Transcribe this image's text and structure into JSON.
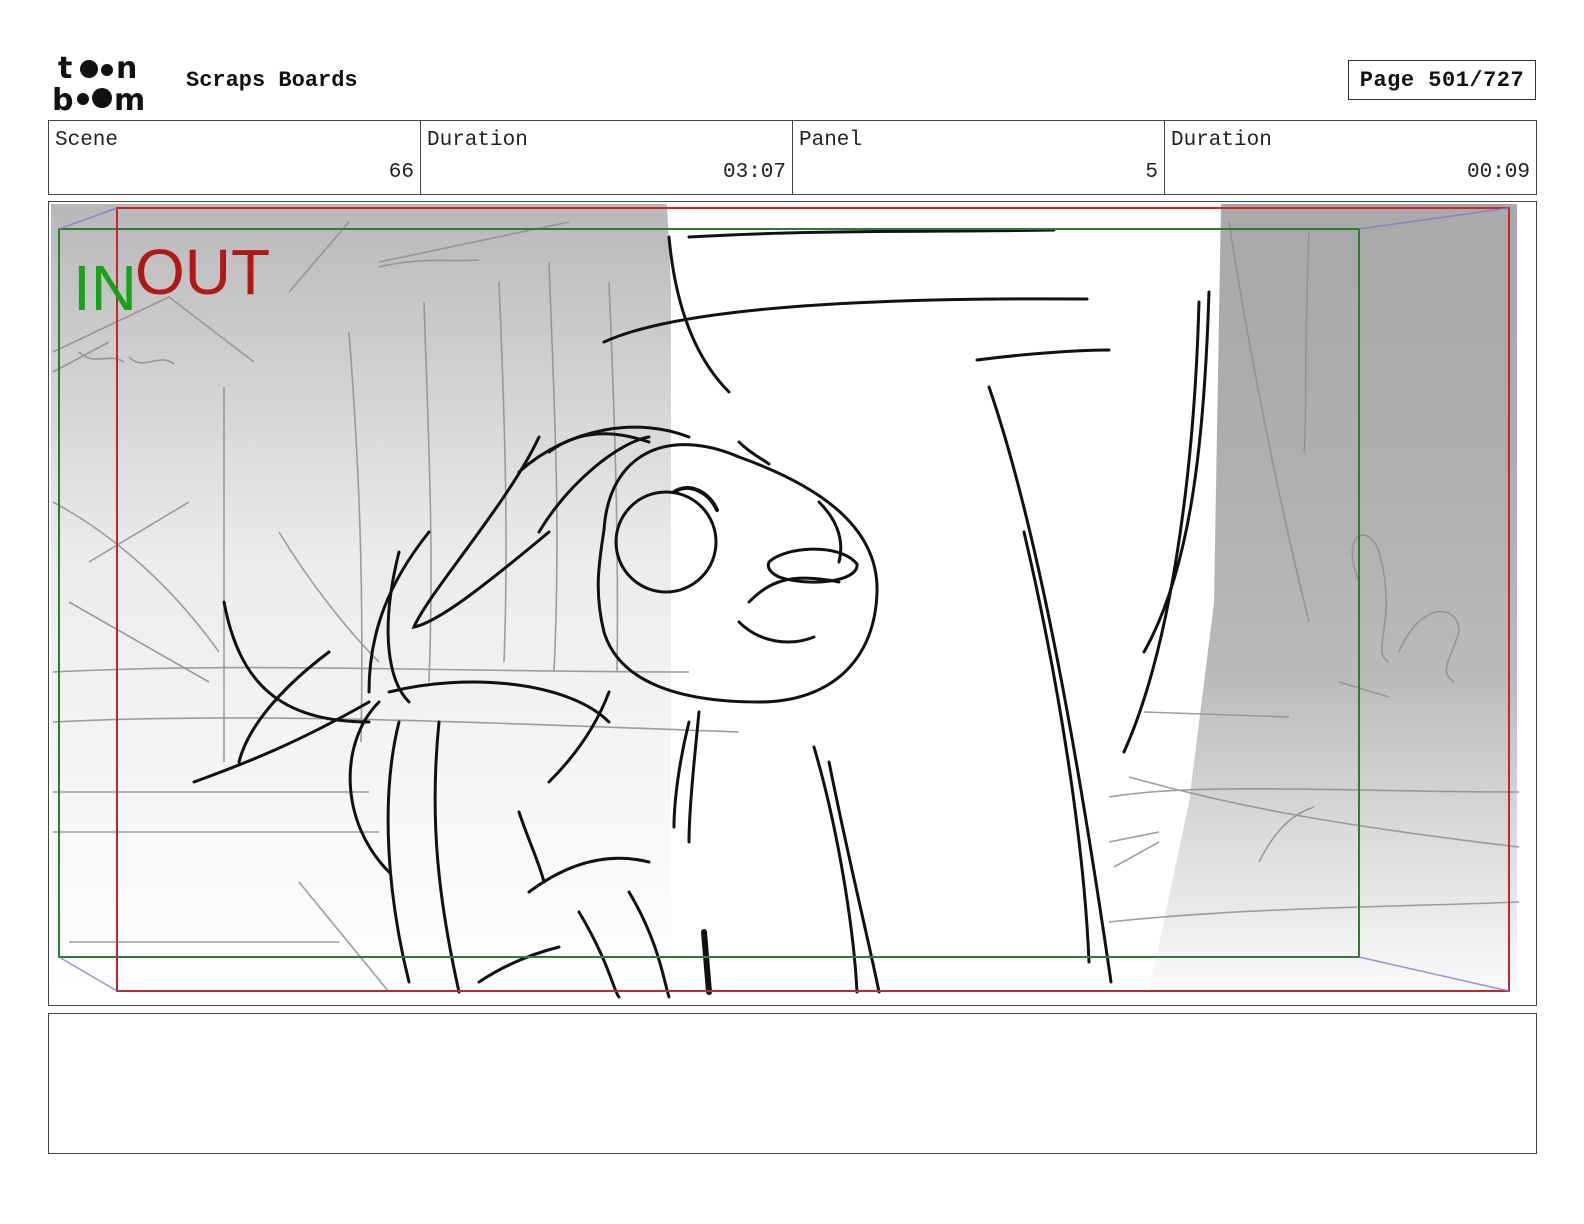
{
  "header": {
    "logo_lines": [
      "toon",
      "boom"
    ],
    "title": "Scraps Boards",
    "page_label": "Page 501/727"
  },
  "info": {
    "scene_label": "Scene",
    "scene_value": "66",
    "scene_duration_label": "Duration",
    "scene_duration_value": "03:07",
    "panel_label": "Panel",
    "panel_value": "5",
    "panel_duration_label": "Duration",
    "panel_duration_value": "00:09"
  },
  "panel": {
    "in_label": "IN",
    "out_label": "OUT",
    "in_color": "#1aa01a",
    "out_color": "#b01818",
    "in_frame_color": "#2e7d2e",
    "out_frame_color": "#c0282c"
  },
  "notes": {
    "text": ""
  }
}
